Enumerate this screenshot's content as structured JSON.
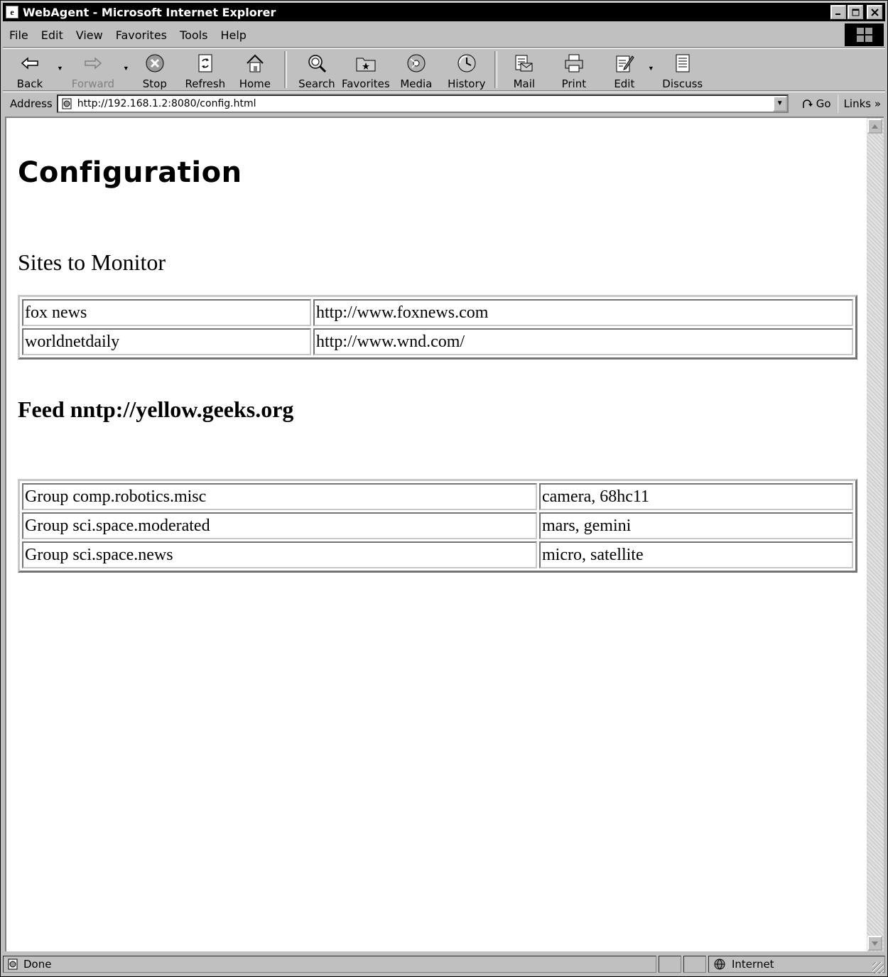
{
  "window": {
    "title": "WebAgent - Microsoft Internet Explorer"
  },
  "menu": [
    "File",
    "Edit",
    "View",
    "Favorites",
    "Tools",
    "Help"
  ],
  "toolbar": {
    "back": "Back",
    "forward": "Forward",
    "stop": "Stop",
    "refresh": "Refresh",
    "home": "Home",
    "search": "Search",
    "favorites": "Favorites",
    "media": "Media",
    "history": "History",
    "mail": "Mail",
    "print": "Print",
    "edit": "Edit",
    "discuss": "Discuss"
  },
  "address": {
    "label": "Address",
    "url": "http://192.168.1.2:8080/config.html",
    "go": "Go",
    "links": "Links"
  },
  "page": {
    "heading": "Configuration",
    "sites_heading": "Sites to Monitor",
    "sites": [
      {
        "name": "fox news",
        "url": "http://www.foxnews.com"
      },
      {
        "name": "worldnetdaily",
        "url": "http://www.wnd.com/"
      }
    ],
    "feed_heading": "Feed nntp://yellow.geeks.org",
    "groups": [
      {
        "group": "Group comp.robotics.misc",
        "keywords": "camera, 68hc11"
      },
      {
        "group": "Group sci.space.moderated",
        "keywords": "mars, gemini"
      },
      {
        "group": "Group sci.space.news",
        "keywords": "micro, satellite"
      }
    ]
  },
  "status": {
    "text": "Done",
    "zone": "Internet"
  }
}
